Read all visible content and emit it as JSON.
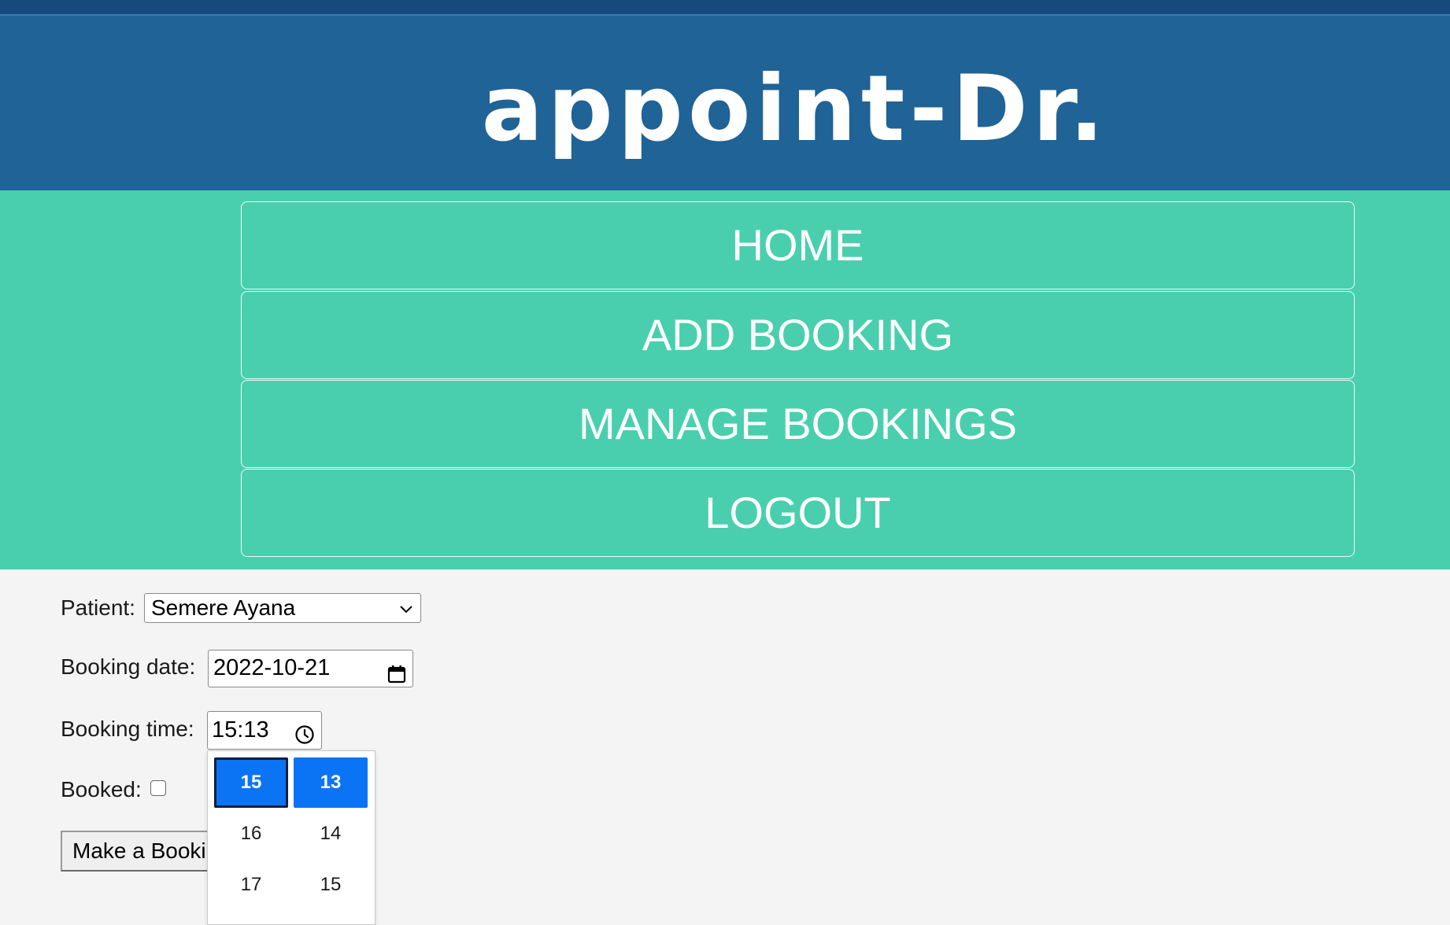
{
  "app": {
    "title": "appoint-Dr."
  },
  "nav": {
    "items": [
      {
        "label": "HOME"
      },
      {
        "label": "ADD BOOKING"
      },
      {
        "label": "MANAGE BOOKINGS"
      },
      {
        "label": "LOGOUT"
      }
    ]
  },
  "form": {
    "patient_label": "Patient:",
    "patient_value": "Semere Ayana",
    "date_label": "Booking date:",
    "date_value": "2022-10-21",
    "time_label": "Booking time:",
    "time_value": "15:13",
    "booked_label": "Booked:",
    "booked_checked": false,
    "submit_label": "Make a Booking"
  },
  "time_picker": {
    "hours": [
      "15",
      "16",
      "17"
    ],
    "minutes": [
      "13",
      "14",
      "15"
    ],
    "selected_hour": "15",
    "selected_minute": "13"
  },
  "colors": {
    "header_bg": "#206396",
    "nav_bg": "#4acfae",
    "accent": "#0a74f5",
    "page_bg": "#f4f4f4"
  },
  "icons": {
    "date": "calendar-icon",
    "time": "clock-icon",
    "select": "chevron-down-icon"
  }
}
